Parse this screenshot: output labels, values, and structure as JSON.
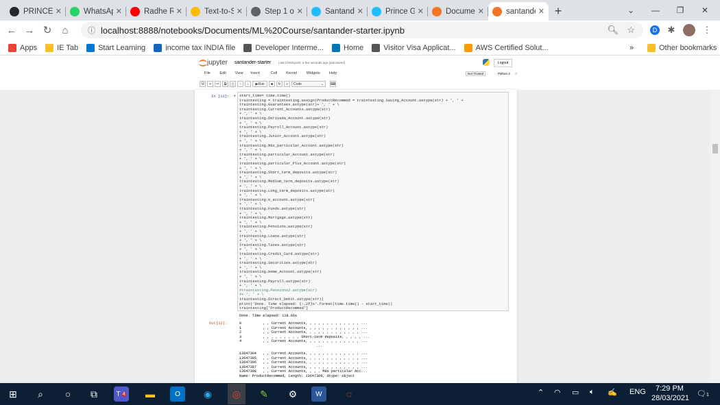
{
  "browser": {
    "tabs": [
      {
        "label": "PRINCEM",
        "icon": "github-icon",
        "color": "#24292e"
      },
      {
        "label": "WhatsAp",
        "icon": "whatsapp-icon",
        "color": "#25d366"
      },
      {
        "label": "Radhe Ra",
        "icon": "youtube-icon",
        "color": "#ff0000"
      },
      {
        "label": "Text-to-S",
        "icon": "google-drive-icon",
        "color": "#fbbc04"
      },
      {
        "label": "Step 1 of",
        "icon": "gear-icon",
        "color": "#5f6368"
      },
      {
        "label": "Santande",
        "icon": "kaggle-icon",
        "color": "#20beff"
      },
      {
        "label": "Prince G",
        "icon": "kaggle-icon",
        "color": "#20beff"
      },
      {
        "label": "Documen",
        "icon": "jupyter-icon",
        "color": "#f37626"
      },
      {
        "label": "santande",
        "icon": "jupyter-icon",
        "color": "#f37626"
      }
    ],
    "url": "localhost:8888/notebooks/Documents/ML%20Course/santander-starter.ipynb",
    "profile_initial": "D",
    "bookmarks": [
      "Apps",
      "IE Tab",
      "Start Learning",
      "income tax INDIA file",
      "Developer Interme...",
      "Home",
      "Visitor Visa Applicat...",
      "AWS Certified Solut..."
    ],
    "other_bookmarks": "Other bookmarks",
    "more": "»"
  },
  "jupyter": {
    "logo": "jupyter",
    "title": "santander-starter",
    "checkpoint": "Last Checkpoint: a few seconds ago  (autosaved)",
    "logout": "Logout",
    "menu": [
      "File",
      "Edit",
      "View",
      "Insert",
      "Cell",
      "Kernel",
      "Widgets",
      "Help"
    ],
    "trusted": "Not Trusted",
    "kernel": "Python 3",
    "celltype": "Code",
    "run_label": "Run",
    "in_prompt": "In [12]:",
    "out_prompt": "Out[12]:",
    "code_lines": [
      "start_time= time.time()",
      "traintesting = traintesting.assign(ProductRecommed = traintesting.Saving_Account.astype(str) + ', ' +",
      "traintesting.Guarantees.astype(str)+ ', ' + \\",
      "traintesting.Current_Accounts.astype(str)",
      "+ ', ' + \\",
      "traintesting.Derivada_Account.astype(str)",
      "+ ', ' + \\",
      "traintesting.Payroll_Account.astype(str)",
      "+ ', ' + \\",
      "traintesting.Junior_Account.astype(str)",
      "+ ', ' + \\",
      "traintesting.Más_particular_Account.astype(str)",
      "+ ', ' + \\",
      "traintesting.particular_Account.astype(str)",
      "+ ', ' + \\",
      "traintesting.particular_Plus_Account.astype(str)",
      "+ ', ' + \\",
      "traintesting.Short_term_deposits.astype(str)",
      "+ ', ' + \\",
      "traintesting.Medium_term_deposits.astype(str)",
      "+ ', ' + \\",
      "traintesting.Long_term_deposits.astype(str)",
      "+ ', ' + \\",
      "traintesting.e_account.astype(str)",
      "+ ', ' + \\",
      "traintesting.Funds.astype(str)",
      "+ ', ' + \\",
      "traintesting.Mortgage.astype(str)",
      "+ ', ' + \\",
      "traintesting.Pensions.astype(str)",
      "+ ', ' + \\",
      "traintesting.Loans.astype(str)",
      "+ ', ' + \\",
      "traintesting.Taxes.astype(str)",
      "+ ', ' + \\",
      "traintesting.Credit_Card.astype(str)",
      "+ ', ' + \\",
      "traintesting.Securities.astype(str)",
      "+ ', ' + \\",
      "traintesting.Home_Account.astype(str)",
      "+ ', ' + \\",
      "traintesting.Payroll.astype(str)",
      "+ ', ' + \\",
      "#traintesting.Pensions2.astype(str)",
      "#+ ', ' + \\",
      "traintesting.Direct_Debit.astype(str))",
      "print('Done. Time elapsed: {:.2f}s'.format(time.time() - start_time))",
      "traintesting['ProductRecommed']"
    ],
    "stdout": "Done. Time elapsed: 118.66s",
    "output_lines": [
      "0          , , Current Accounts, , , , , , , , , , , , , ...",
      "1          , , Current Accounts, , , , , , , , , , , , , ...",
      "2          , , Current Accounts, , , , , , , , , , , , , ...",
      "3          , , , , , , , , , Short-term deposits, , , , , ...",
      "4          , , Current Accounts, , , , , , , , , , , , , ...",
      "                                    ...",
      "13647304   , , Current Accounts, , , , , , , , , , , , , ...",
      "13647305   , , Current Accounts, , , , , , , , , , , , , ...",
      "13647306   , , Current Accounts, , , , , , , , , , , , , ...",
      "13647307   , , Current Accounts, , , , , , , , , , , , , ...",
      "13647308   , , Current Accounts, , , , Más particular Acc...",
      "Name: ProductRecommed, Length: 13647309, dtype: object"
    ]
  },
  "taskbar": {
    "lang": "ENG",
    "time": "7:29 PM",
    "date": "28/03/2021",
    "teams_badge": "4",
    "notif_badge": "1"
  }
}
